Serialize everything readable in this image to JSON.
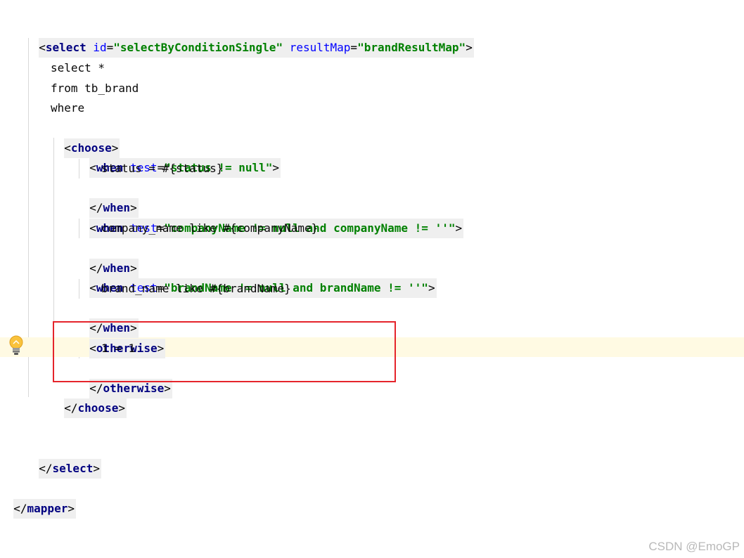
{
  "code": {
    "select_open": {
      "tag": "select",
      "attrs": [
        {
          "name": "id",
          "value": "\"selectByConditionSingle\""
        },
        {
          "name": "resultMap",
          "value": "\"brandResultMap\""
        }
      ]
    },
    "sql1": "select *",
    "sql2": "from tb_brand",
    "sql3": "where",
    "choose_open": "choose",
    "when1": {
      "tag": "when",
      "attr": "test",
      "value": "\"status != null\""
    },
    "when1_body": "status = #{status}",
    "when_close": "when",
    "when2": {
      "tag": "when",
      "attr": "test",
      "value": "\"companyName != null and companyName != ''\""
    },
    "when2_body": "company_name like #{companyName}",
    "when3": {
      "tag": "when",
      "attr": "test",
      "value": "\"brandName != null and brandName != ''\""
    },
    "when3_body": "brand_name like #{brandName}",
    "otherwise_open": "otherwise",
    "otherwise_body": "1 = 1",
    "otherwise_close": "otherwise",
    "choose_close": "choose",
    "select_close": "select",
    "mapper_close": "mapper"
  },
  "colors": {
    "highlight_line": "#fffae3",
    "red_box": "#e5242b",
    "tag_bg": "#efefef"
  },
  "icons": {
    "gutter": "lightbulb-icon"
  },
  "watermark": "CSDN @EmoGP"
}
